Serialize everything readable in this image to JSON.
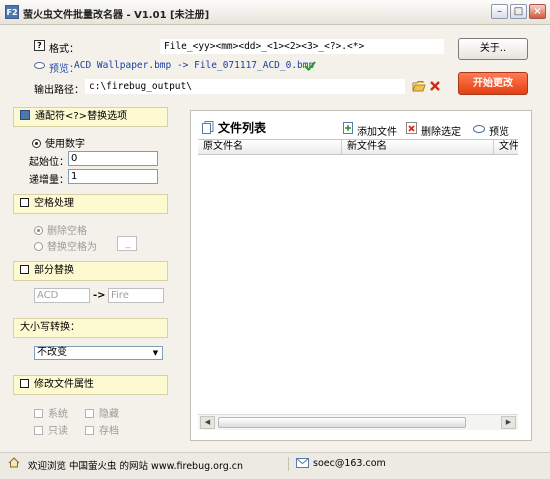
{
  "window": {
    "title": "萤火虫文件批量改名器 - V1.01 [未注册]",
    "app_icon": "F2"
  },
  "top": {
    "format_label": "格式：",
    "format_value": "File_<yy><mm><dd>_<1><2><3>_<?>.<*>",
    "preview_label": "预览：",
    "preview_value": "ACD Wallpaper.bmp -> File_071117_ACD_0.bmp",
    "output_label": "输出路径：",
    "output_value": "c:\\firebug_output\\",
    "about_button": "关于..",
    "start_button": "开始更改"
  },
  "wildcard": {
    "title": "通配符<?>替换选项",
    "use_numbers": "使用数字",
    "start_label": "起始位：",
    "start_value": "0",
    "step_label": "递增量：",
    "step_value": "1"
  },
  "space": {
    "title": "空格处理",
    "delete_label": "删除空格",
    "replace_label": "替换空格为",
    "replace_value": "_"
  },
  "partial": {
    "title": "部分替换",
    "from_value": "ACD",
    "arrow": "->",
    "to_value": "Fire"
  },
  "case": {
    "title": "大小写转换：",
    "selected": "不改变"
  },
  "attrs": {
    "title": "修改文件属性",
    "system": "系统",
    "hidden": "隐藏",
    "readonly": "只读",
    "archive": "存档"
  },
  "filelist": {
    "title": "文件列表",
    "add_label": "添加文件",
    "delete_label": "删除选定",
    "preview_label": "预览",
    "columns": [
      "原文件名",
      "新文件名",
      "文件"
    ]
  },
  "status": {
    "welcome": "欢迎浏览 中国萤火虫 的网站 www.firebug.org.cn",
    "email": "soec@163.com"
  }
}
